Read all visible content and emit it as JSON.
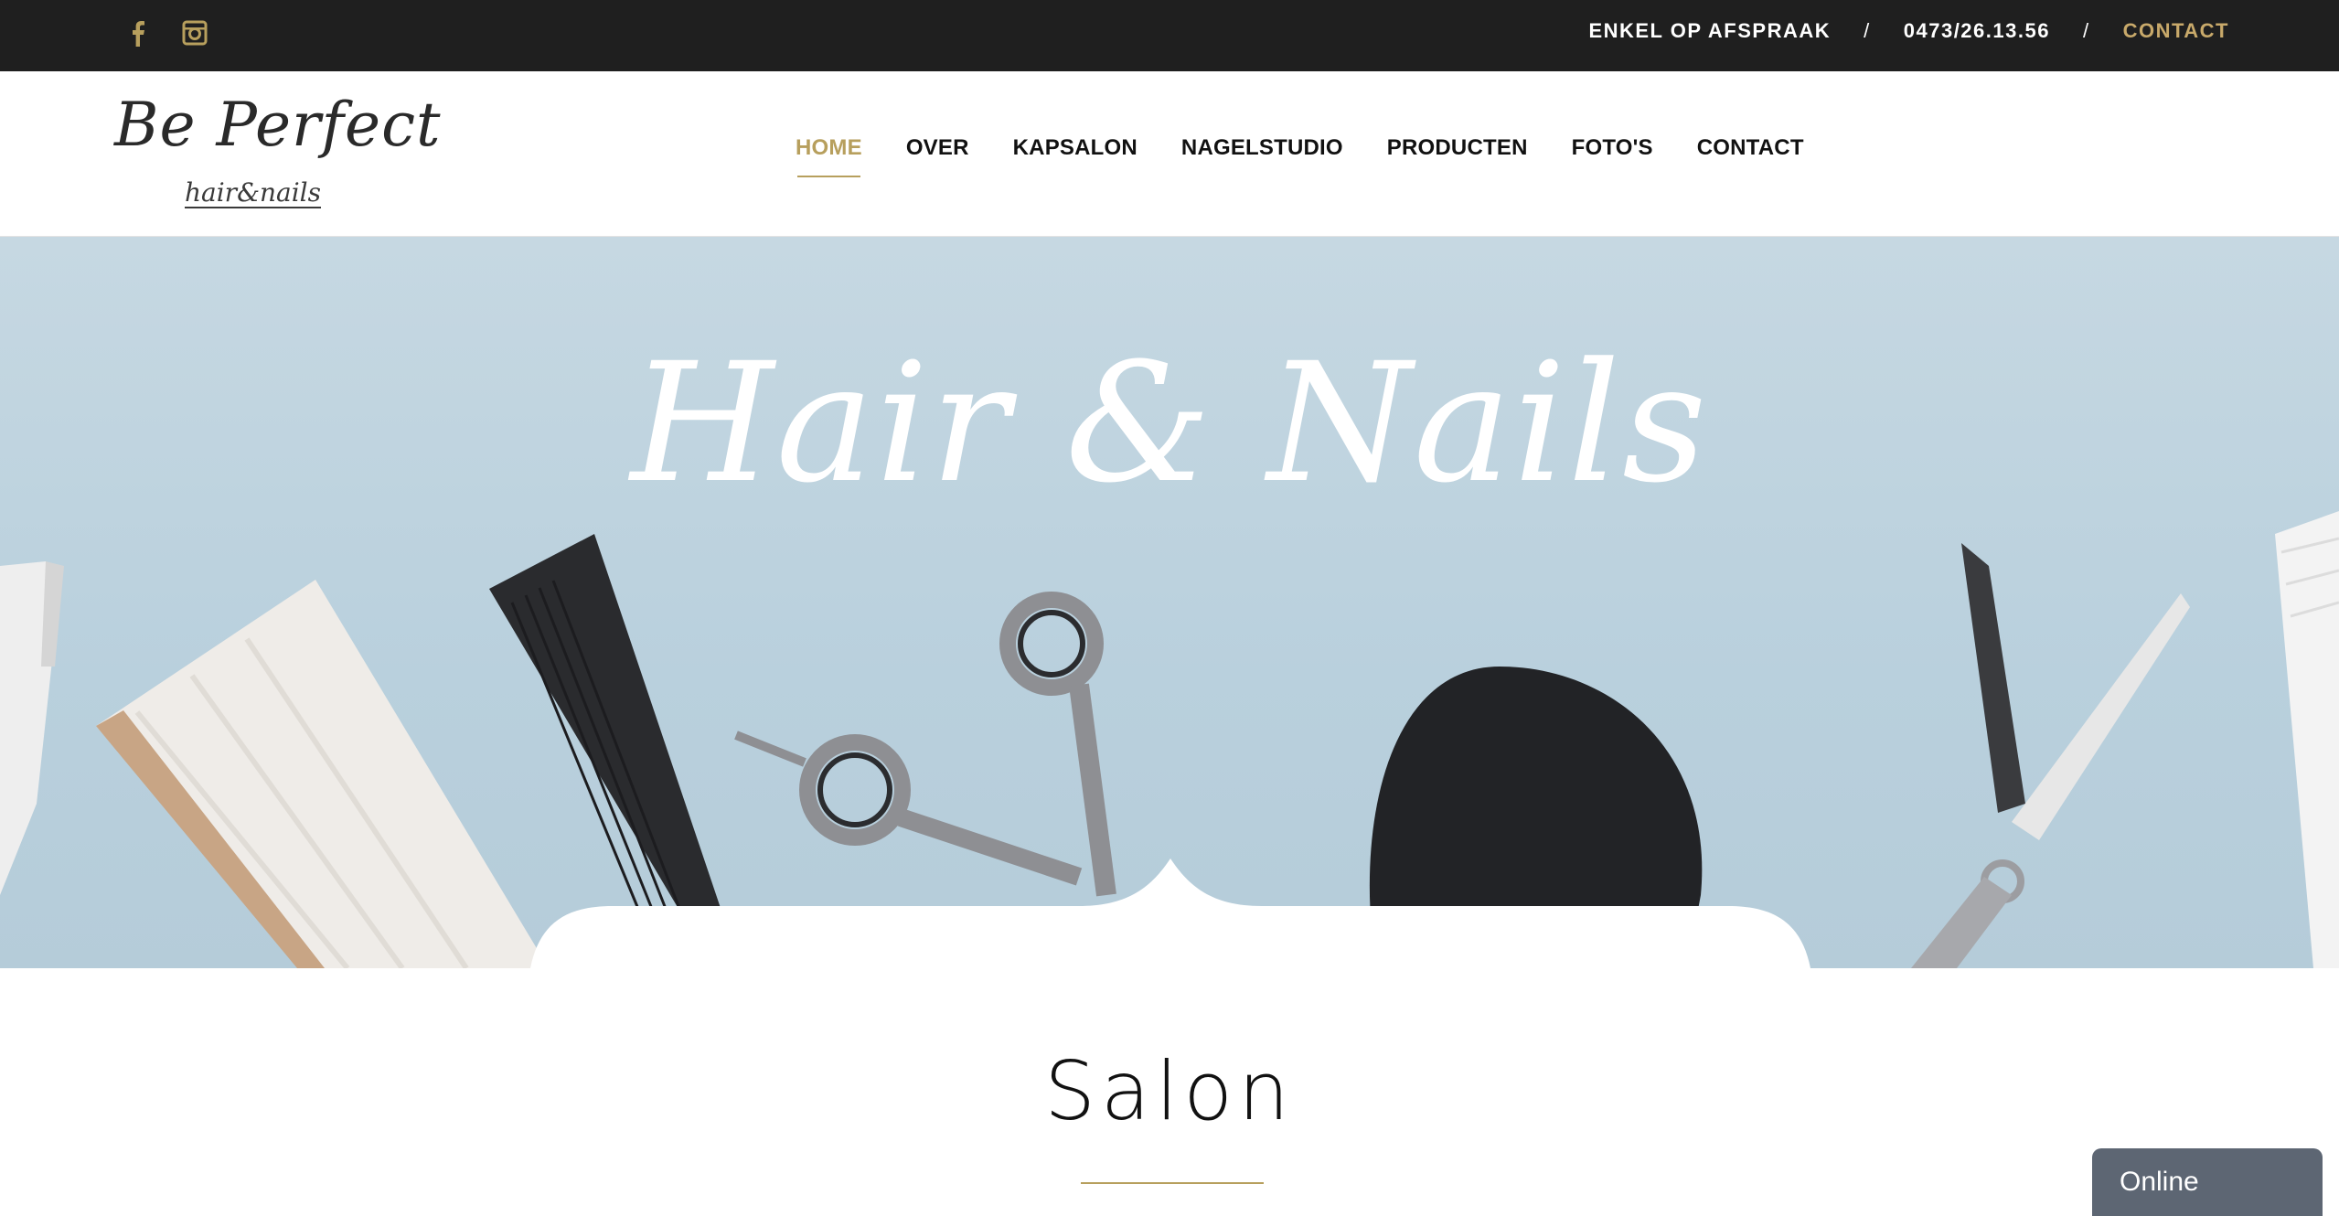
{
  "topbar": {
    "social_icons": [
      "facebook-icon",
      "instagram-icon"
    ],
    "appointment_text": "ENKEL OP AFSPRAAK",
    "separator": "/",
    "phone": "0473/26.13.56",
    "contact_link": "CONTACT",
    "contact_color": "#c8a96a"
  },
  "logo": {
    "main": "Be Perfect",
    "sub": "hair&nails"
  },
  "nav": {
    "items": [
      {
        "label": "HOME",
        "active": true
      },
      {
        "label": "OVER"
      },
      {
        "label": "KAPSALON"
      },
      {
        "label": "NAGELSTUDIO"
      },
      {
        "label": "PRODUCTEN"
      },
      {
        "label": "FOTO'S"
      },
      {
        "label": "CONTACT"
      }
    ],
    "accent_color": "#b79f5d"
  },
  "hero": {
    "title": "Hair & Nails"
  },
  "section": {
    "title": "Salon"
  },
  "chat_widget": {
    "label": "Online"
  }
}
